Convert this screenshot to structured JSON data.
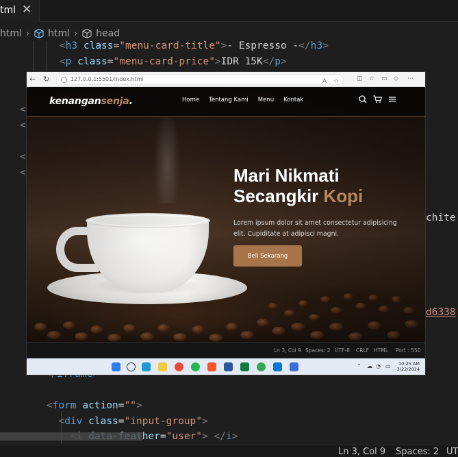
{
  "editor": {
    "tab": {
      "label": "tml",
      "close": "✕"
    },
    "breadcrumb": [
      "html",
      "html",
      "head"
    ],
    "code_lines": {
      "l1": {
        "indent": "    ",
        "open": "<",
        "tag": "h3",
        "attr": "class",
        "eq": "=",
        "val": "\"menu-card-title\"",
        "close": ">",
        "text": "- Espresso -",
        "end_open": "</",
        "end_tag": "h3",
        "end_close": ">"
      },
      "l2": {
        "indent": "    ",
        "open": "<",
        "tag": "p",
        "attr": "class",
        "eq": "=",
        "val": "\"menu-card-price\"",
        "close": ">",
        "text": "IDR 15K",
        "end_open": "</",
        "end_tag": "p",
        "end_close": ">"
      },
      "l3": {
        "indent": "  ",
        "end_open": "</",
        "tag": "iframe",
        "end_close": ">"
      },
      "l4": {
        "open": "<",
        "tag": "form",
        "attr": "action",
        "eq": "=",
        "val": "\"\"",
        "close": ">"
      },
      "l5": {
        "indent": "  ",
        "open": "<",
        "tag": "div",
        "attr": "class",
        "eq": "=",
        "val": "\"input-group\"",
        "close": ">"
      },
      "l6": {
        "indent": "    ",
        "open": "<",
        "tag": "i",
        "attr": "data-feather",
        "eq": "=",
        "val": "\"user\"",
        "close": ">",
        "end_open": " </",
        "end_tag": "i",
        "end_close": ">"
      }
    },
    "side_fragments": {
      "right_word": "chite",
      "right_hash": "d6338"
    },
    "statusbar": {
      "position": "Ln 3, Col 9",
      "spaces": "Spaces: 2",
      "encoding": "UT"
    }
  },
  "browser": {
    "url": "127.0.0.1:5501/index.html",
    "site": {
      "logo_main": "kenangan",
      "logo_accent": "senja",
      "logo_dot": ".",
      "nav": [
        "Home",
        "Tentang Kami",
        "Menu",
        "Kontak"
      ],
      "hero": {
        "title_line1": "Mari Nikmati",
        "title_line2_prefix": "Secangkir ",
        "title_line2_accent": "Kopi",
        "text": "Lorem ipsum dolor sit amet consectetur adipisicing elit. Cupiditate at adipisci magni.",
        "button": "Beli Sekarang"
      }
    },
    "inner_status": {
      "position": "Ln 3, Col 9",
      "spaces": "Spaces: 2",
      "encoding": "UTF-8",
      "eol": "CRLF",
      "lang": "HTML",
      "port": "Port : 550"
    },
    "taskbar": {
      "time": "10:25 AM",
      "date": "3/22/2024"
    }
  },
  "colors": {
    "accent": "#b6895b",
    "button": "#a8754a",
    "tag": "#569cd6",
    "attr": "#9cdcfe",
    "string": "#ce9178"
  }
}
